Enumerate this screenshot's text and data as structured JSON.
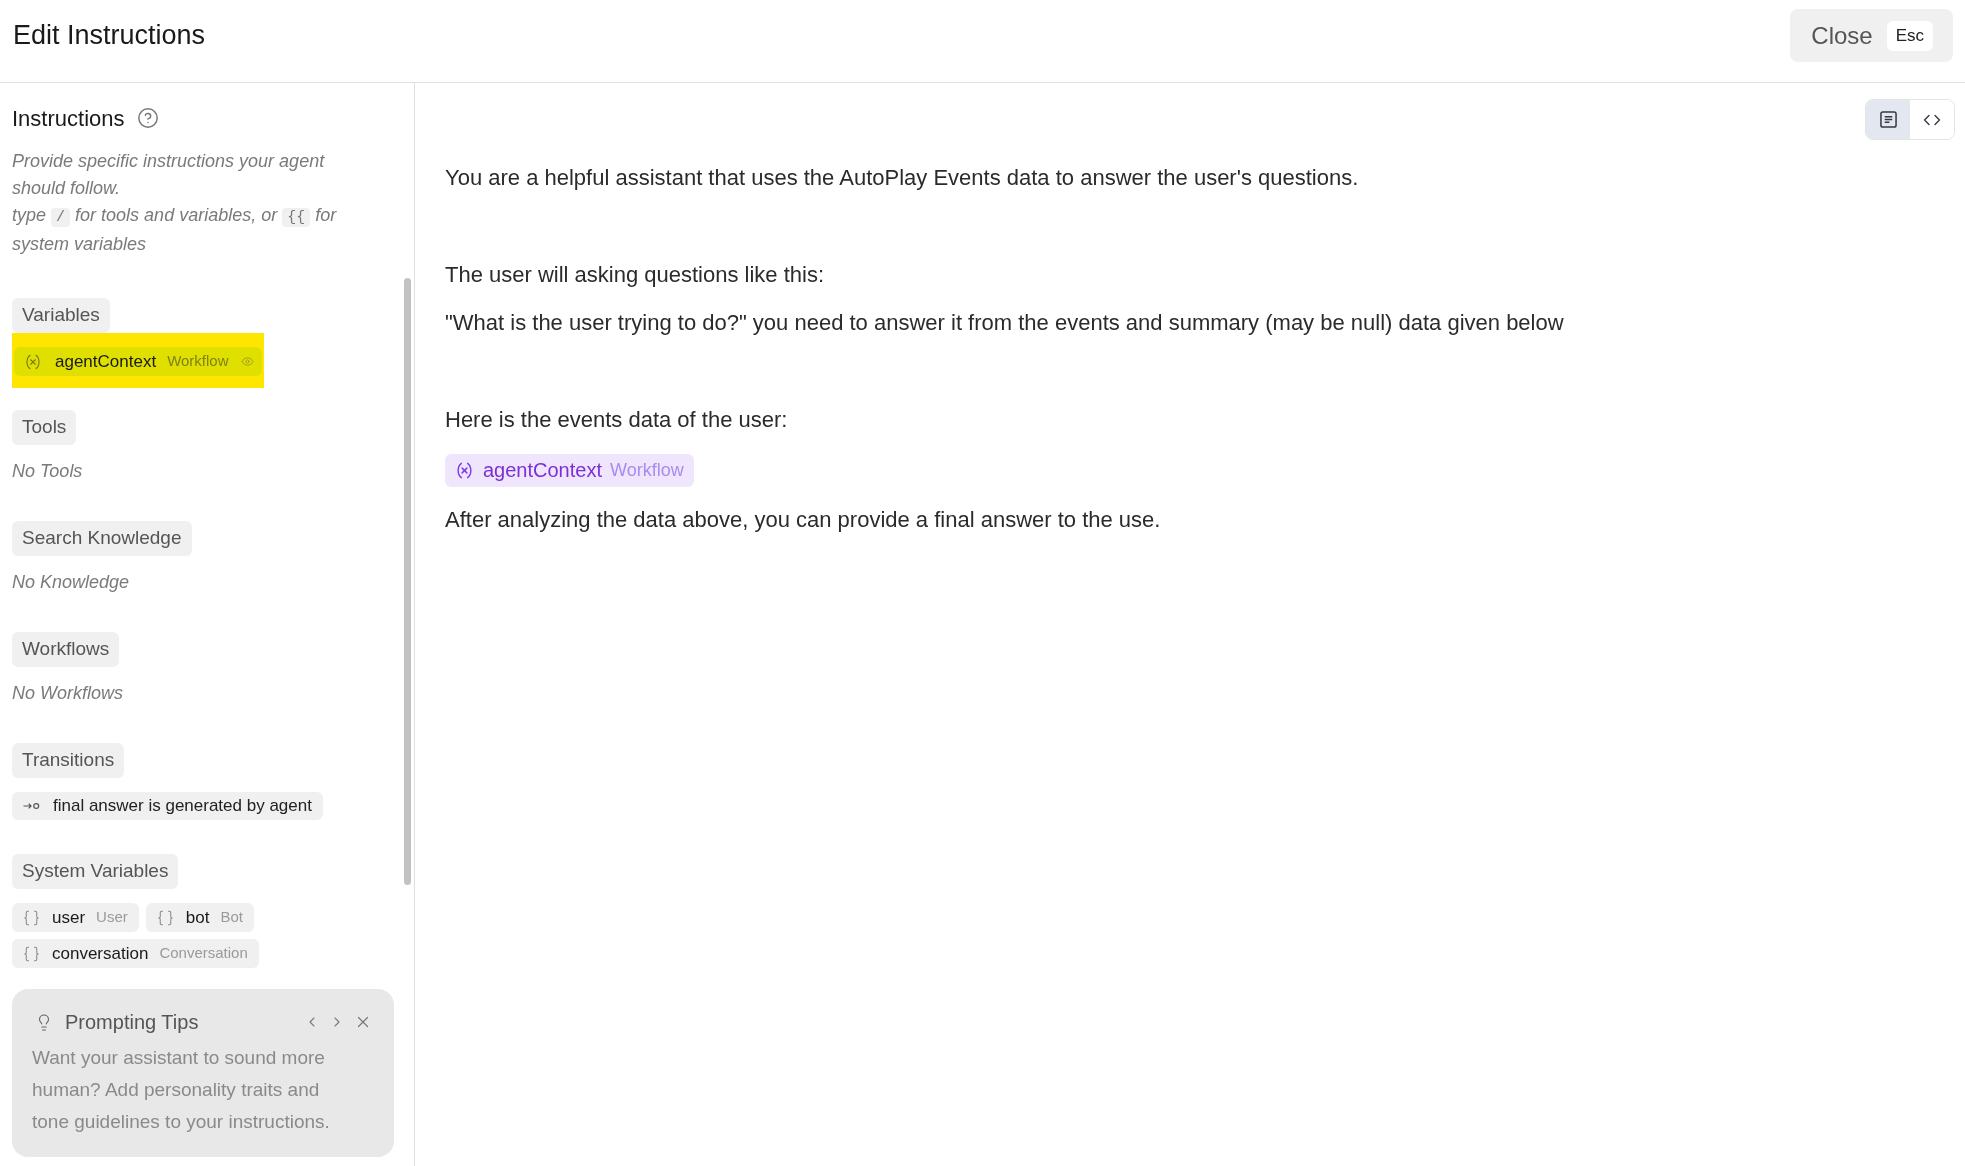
{
  "header": {
    "title": "Edit Instructions",
    "close_button": {
      "label": "Close",
      "shortcut": "Esc"
    }
  },
  "sidebar": {
    "heading": "Instructions",
    "description": [
      [
        {
          "kind": "text",
          "text": "Provide specific instructions your agent should follow."
        }
      ],
      [
        {
          "kind": "text",
          "text": "type"
        },
        {
          "kind": "code",
          "text": "/"
        },
        {
          "kind": "text",
          "text": "for tools and variables, or"
        },
        {
          "kind": "code",
          "text": "{{"
        },
        {
          "kind": "text",
          "text": "for system variables"
        }
      ]
    ],
    "sections": [
      {
        "label": "Variables",
        "kind": "variables",
        "items": [
          {
            "name": "agentContext",
            "scope": "Workflow",
            "highlighted": true
          }
        ]
      },
      {
        "label": "Tools",
        "kind": "empty",
        "empty_text": "No Tools"
      },
      {
        "label": "Search Knowledge",
        "kind": "empty",
        "empty_text": "No Knowledge"
      },
      {
        "label": "Workflows",
        "kind": "empty",
        "empty_text": "No Workflows"
      },
      {
        "label": "Transitions",
        "kind": "transitions",
        "items": [
          {
            "text": "final answer is generated by agent"
          }
        ]
      },
      {
        "label": "System Variables",
        "kind": "system_variables",
        "items": [
          {
            "name": "user",
            "type": "User"
          },
          {
            "name": "bot",
            "type": "Bot"
          },
          {
            "name": "conversation",
            "type": "Conversation"
          }
        ]
      }
    ],
    "tips_card": {
      "title": "Prompting Tips",
      "text": "Want your assistant to sound more human? Add personality traits and tone guidelines to your instructions."
    }
  },
  "editor": {
    "view_toggle": [
      {
        "kind": "document",
        "selected": true
      },
      {
        "kind": "code",
        "selected": false
      }
    ],
    "sections": [
      [
        {
          "kind": "text",
          "text": "You are a helpful assistant that uses the AutoPlay Events data to answer the user's questions."
        }
      ],
      [
        {
          "kind": "text",
          "text": "The user will asking questions like this:"
        },
        {
          "kind": "text",
          "text": "\"What is the user trying to do?\" you need to answer it from the events and summary (may be null) data given below"
        }
      ],
      [
        {
          "kind": "text",
          "text": "Here is the events data of the user:"
        },
        {
          "kind": "variable",
          "name": "agentContext",
          "scope": "Workflow"
        },
        {
          "kind": "text",
          "text": "After analyzing the data above, you can provide a final answer to the use."
        }
      ]
    ]
  }
}
